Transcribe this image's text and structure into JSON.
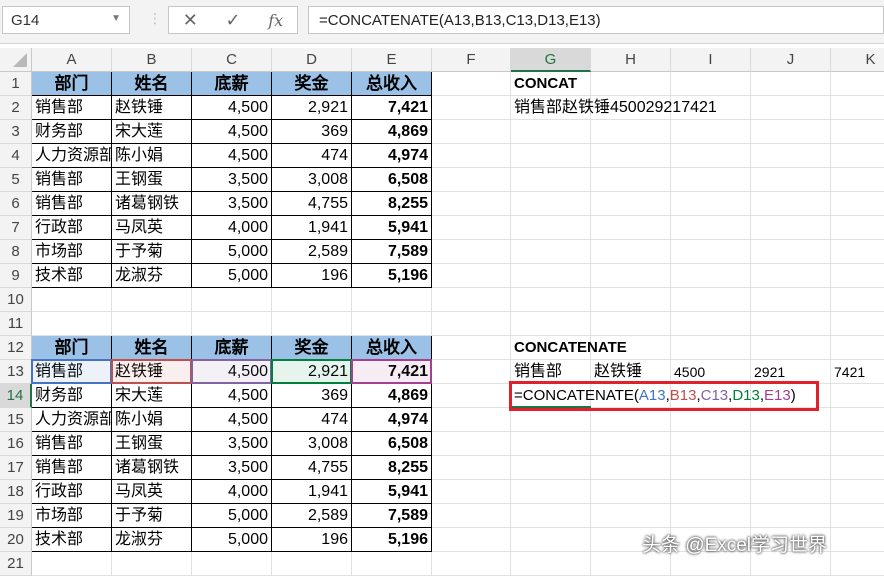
{
  "name_box": "G14",
  "formula_bar": "=CONCATENATE(A13,B13,C13,D13,E13)",
  "columns": [
    "A",
    "B",
    "C",
    "D",
    "E",
    "F",
    "G",
    "H",
    "I",
    "J",
    "K"
  ],
  "selected_column": "G",
  "selected_row": 14,
  "table_headers": [
    "部门",
    "姓名",
    "底薪",
    "奖金",
    "总收入"
  ],
  "rows": [
    [
      "销售部",
      "赵铁锤",
      "4,500",
      "2,921",
      "7,421"
    ],
    [
      "财务部",
      "宋大莲",
      "4,500",
      "369",
      "4,869"
    ],
    [
      "人力资源部",
      "陈小娟",
      "4,500",
      "474",
      "4,974"
    ],
    [
      "销售部",
      "王钢蛋",
      "3,500",
      "3,008",
      "6,508"
    ],
    [
      "销售部",
      "诸葛钢铁",
      "3,500",
      "4,755",
      "8,255"
    ],
    [
      "行政部",
      "马凤英",
      "4,000",
      "1,941",
      "5,941"
    ],
    [
      "市场部",
      "于予菊",
      "5,000",
      "2,589",
      "7,589"
    ],
    [
      "技术部",
      "龙淑芬",
      "5,000",
      "196",
      "5,196"
    ]
  ],
  "concat": {
    "label": "CONCAT",
    "result": "销售部赵铁锤450029217421"
  },
  "concatenate": {
    "label": "CONCATENATE",
    "parts": [
      "销售部",
      "赵铁锤",
      "4500",
      "2921",
      "7421"
    ],
    "editing": {
      "prefix": "=CONCATENATE(",
      "args": [
        "A13",
        "B13",
        "C13",
        "D13",
        "E13"
      ],
      "suffix": ")"
    }
  },
  "ref_colors": [
    "#4472c4",
    "#c0504d",
    "#8064a2",
    "#00803c",
    "#a3408f"
  ],
  "watermark": "头条 @Excel学习世界"
}
